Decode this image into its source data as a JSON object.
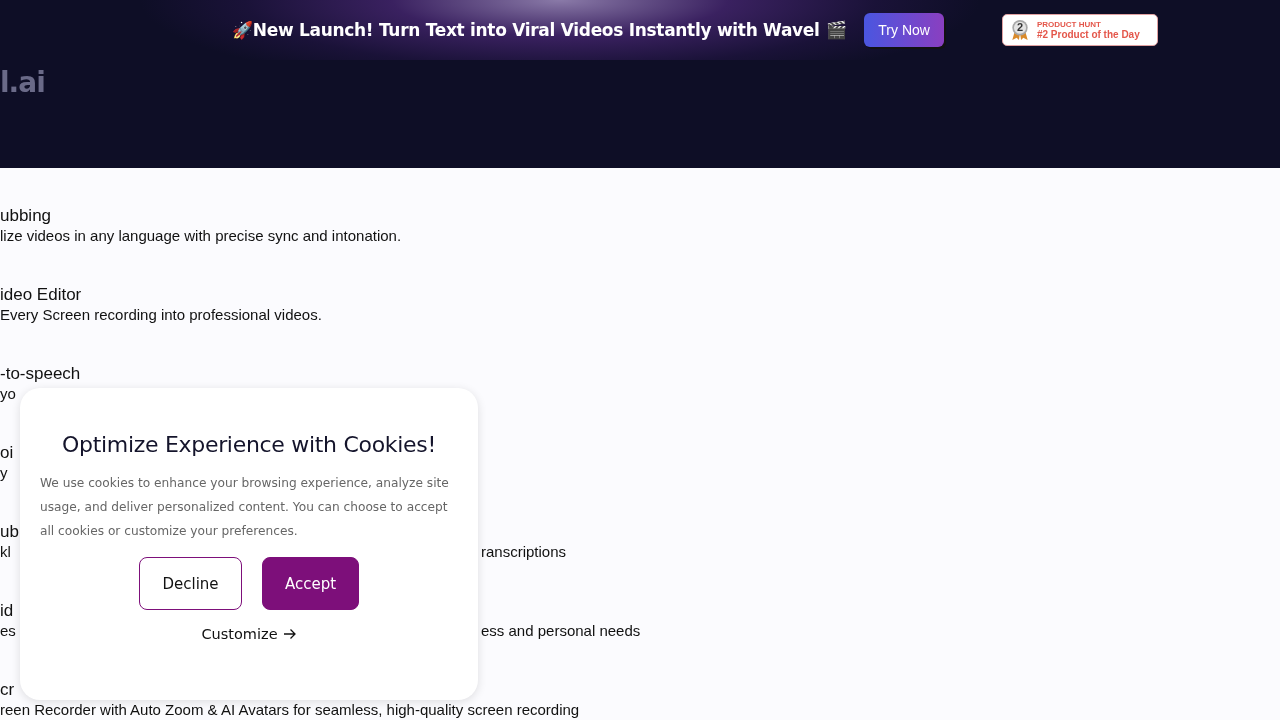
{
  "announcement": {
    "rocket": "🚀",
    "text": "New Launch! Turn Text into Viral Videos Instantly with Wavel",
    "clapper": "🎬",
    "button": "Try Now",
    "badge": {
      "overline": "PRODUCT HUNT",
      "label": "#2 Product of the Day",
      "rank": "2"
    }
  },
  "logo": "l.ai",
  "features": [
    {
      "title": "ubbing",
      "description": [
        "lize videos in any language with precise sync and intonation."
      ]
    },
    {
      "title": "ideo Editor",
      "description": [
        "Every Screen recording into professional videos."
      ]
    },
    {
      "title": "-to-speech",
      "description": [
        "yo"
      ]
    },
    {
      "title": "oi",
      "description": [
        "y"
      ]
    },
    {
      "title": "ub",
      "description": [
        "kl",
        "ranscriptions"
      ]
    },
    {
      "title": "id",
      "description": [
        "es",
        "ess and personal needs"
      ]
    },
    {
      "title": "cr",
      "description": [
        "reen Recorder with Auto Zoom & AI Avatars for seamless, high-quality screen recording"
      ]
    }
  ],
  "cookie_dialog": {
    "title": "Optimize Experience with Cookies!",
    "body": "We use cookies to enhance your browsing experience, analyze site usage, and deliver personalized content. You can choose to accept all cookies or customize your preferences.",
    "buttons": [
      {
        "label": "Decline",
        "kind": "outline"
      },
      {
        "label": "Accept",
        "kind": "filled"
      }
    ],
    "link": "Customize"
  }
}
